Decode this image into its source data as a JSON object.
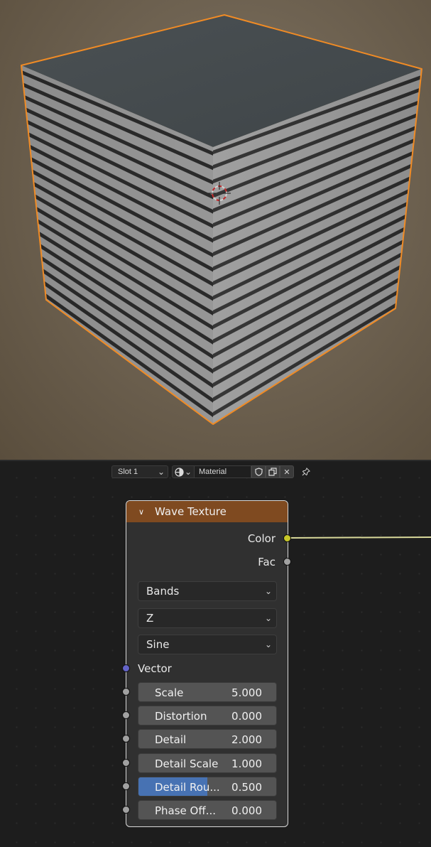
{
  "viewport": {
    "object": "cube",
    "selection_outline_color": "#f08b25",
    "cursor_icon": "3d-cursor-icon"
  },
  "header": {
    "slot_label": "Slot 1",
    "browse_icon": "material-sphere-icon",
    "material_name": "Material",
    "fake_user_icon": "shield-icon",
    "duplicate_icon": "duplicate-icon",
    "unlink_icon": "close-icon",
    "pin_icon": "pin-icon"
  },
  "node": {
    "title": "Wave Texture",
    "header_color": "#7f4a20",
    "outputs": [
      {
        "label": "Color",
        "socket_color": "#c7c729",
        "connected": true
      },
      {
        "label": "Fac",
        "socket_color": "#a1a1a1",
        "connected": false
      }
    ],
    "wave_type": "Bands",
    "direction": "Z",
    "profile": "Sine",
    "vector_label": "Vector",
    "inputs": [
      {
        "label": "Scale",
        "value": "5.000",
        "fill": 0
      },
      {
        "label": "Distortion",
        "value": "0.000",
        "fill": 0
      },
      {
        "label": "Detail",
        "value": "2.000",
        "fill": 0
      },
      {
        "label": "Detail Scale",
        "value": "1.000",
        "fill": 0
      },
      {
        "label": "Detail Rou...",
        "value": "0.500",
        "fill": 0.5
      },
      {
        "label": "Phase Off...",
        "value": "0.000",
        "fill": 0
      }
    ]
  }
}
